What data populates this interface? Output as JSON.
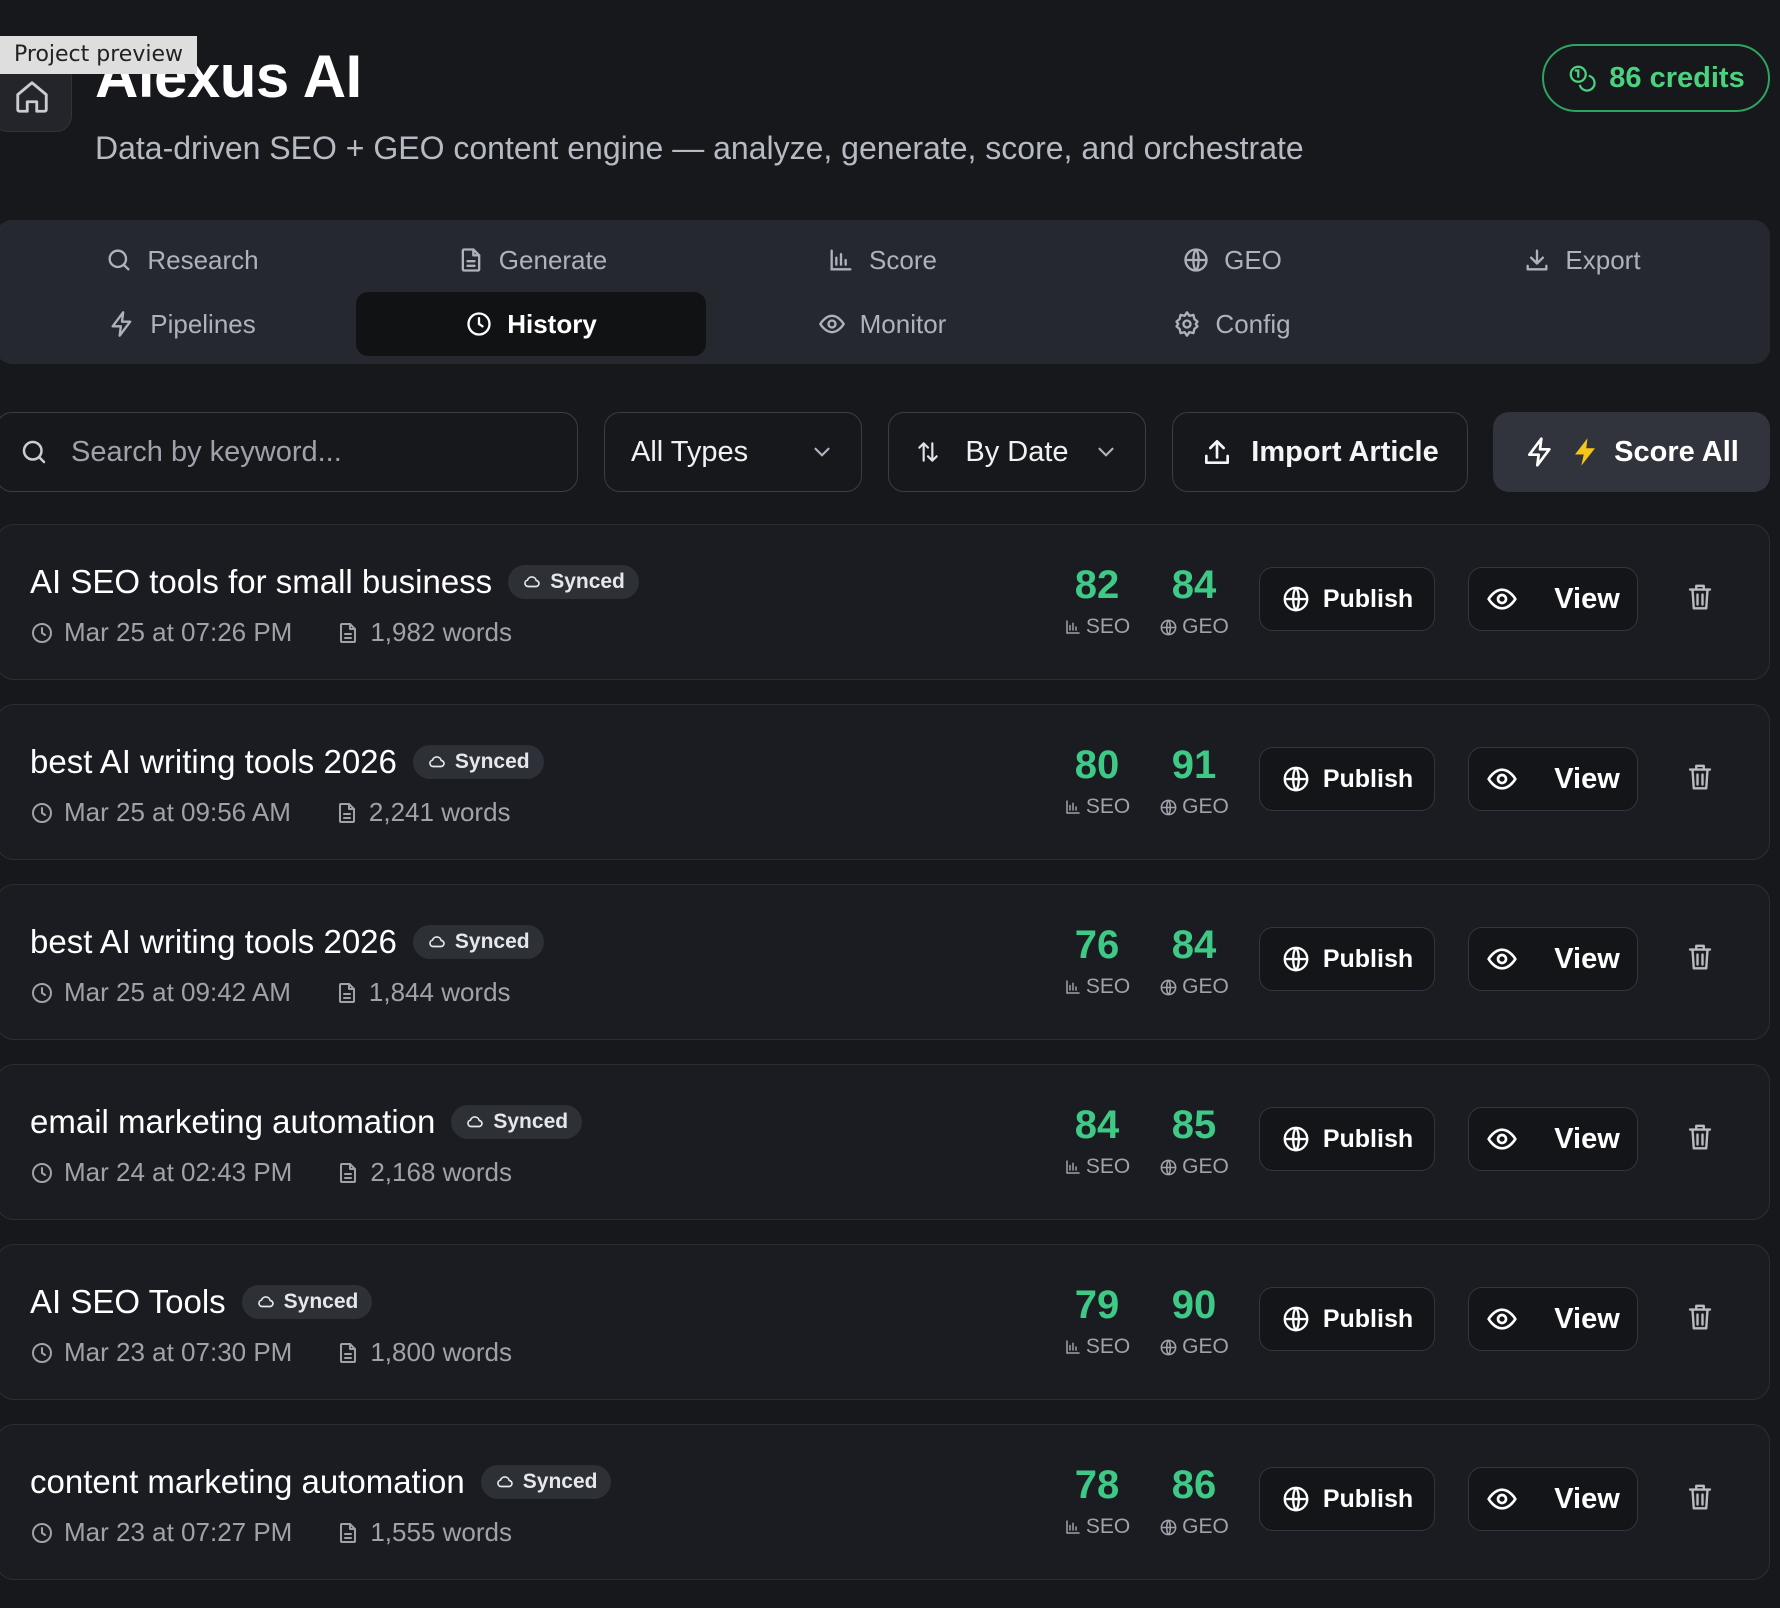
{
  "preview_label": "Project preview",
  "header": {
    "title": "Alexus AI",
    "subtitle": "Data-driven SEO + GEO content engine — analyze, generate, score, and orchestrate",
    "credits": "86 credits"
  },
  "nav": {
    "tabs": [
      {
        "label": "Research",
        "icon": "search-icon"
      },
      {
        "label": "Generate",
        "icon": "document-icon"
      },
      {
        "label": "Score",
        "icon": "bar-chart-icon"
      },
      {
        "label": "GEO",
        "icon": "globe-icon"
      },
      {
        "label": "Export",
        "icon": "download-icon"
      },
      {
        "label": "Pipelines",
        "icon": "lightning-icon"
      },
      {
        "label": "History",
        "icon": "clock-icon",
        "active": true
      },
      {
        "label": "Monitor",
        "icon": "eye-icon"
      },
      {
        "label": "Config",
        "icon": "gear-icon"
      }
    ]
  },
  "toolbar": {
    "search_placeholder": "Search by keyword...",
    "type_filter": "All Types",
    "sort": "By Date",
    "import_label": "Import Article",
    "score_all_label": "Score All"
  },
  "labels": {
    "synced": "Synced",
    "seo": "SEO",
    "geo": "GEO",
    "publish": "Publish",
    "view": "View"
  },
  "colors": {
    "score_green": "#3ec987",
    "credits_green": "#4ad27e",
    "lightning_yellow": "#f5c518"
  },
  "articles": [
    {
      "keyword": "AI SEO tools for small business",
      "date": "Mar 25 at 07:26 PM",
      "words": "1,982 words",
      "seo": "82",
      "geo": "84"
    },
    {
      "keyword": "best AI writing tools 2026",
      "date": "Mar 25 at 09:56 AM",
      "words": "2,241 words",
      "seo": "80",
      "geo": "91"
    },
    {
      "keyword": "best AI writing tools 2026",
      "date": "Mar 25 at 09:42 AM",
      "words": "1,844 words",
      "seo": "76",
      "geo": "84"
    },
    {
      "keyword": "email marketing automation",
      "date": "Mar 24 at 02:43 PM",
      "words": "2,168 words",
      "seo": "84",
      "geo": "85"
    },
    {
      "keyword": "AI SEO Tools",
      "date": "Mar 23 at 07:30 PM",
      "words": "1,800 words",
      "seo": "79",
      "geo": "90"
    },
    {
      "keyword": "content marketing automation",
      "date": "Mar 23 at 07:27 PM",
      "words": "1,555 words",
      "seo": "78",
      "geo": "86"
    }
  ]
}
